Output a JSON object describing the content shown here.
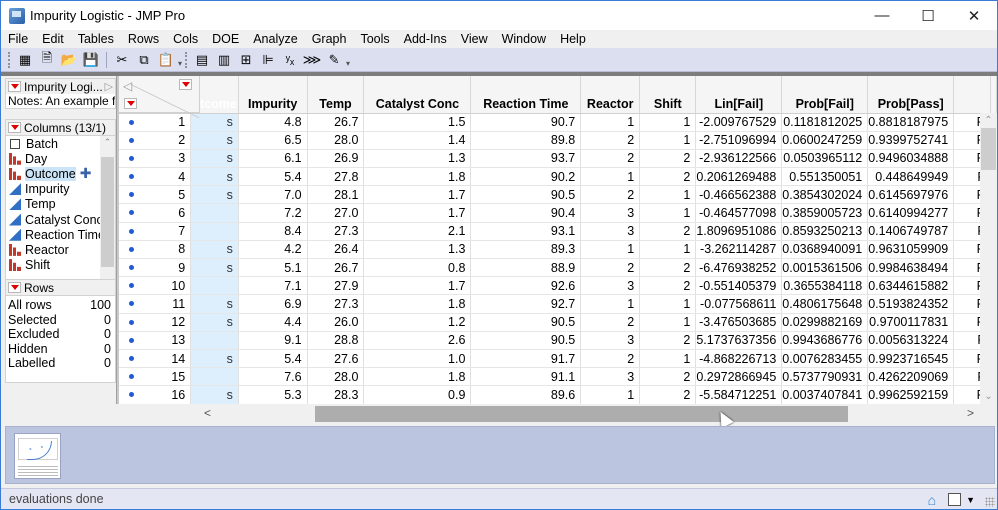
{
  "window": {
    "title": "Impurity Logistic - JMP Pro",
    "controls": {
      "minimize": "—",
      "maximize": "☐",
      "close": "✕"
    }
  },
  "menu": [
    "File",
    "Edit",
    "Tables",
    "Rows",
    "Cols",
    "DOE",
    "Analyze",
    "Graph",
    "Tools",
    "Add-Ins",
    "View",
    "Window",
    "Help"
  ],
  "toolbar": {
    "group1": [
      {
        "name": "new-data-table-icon",
        "glyph": "▦"
      },
      {
        "name": "new-script-icon",
        "glyph": "🗎"
      },
      {
        "name": "open-icon",
        "glyph": "📂"
      },
      {
        "name": "save-icon",
        "glyph": "💾"
      }
    ],
    "group2": [
      {
        "name": "cut-icon",
        "glyph": "✂"
      },
      {
        "name": "copy-icon",
        "glyph": "⧉"
      },
      {
        "name": "paste-icon",
        "glyph": "📋"
      }
    ],
    "group3": [
      {
        "name": "data-table-icon",
        "glyph": "▤"
      },
      {
        "name": "calculator-icon",
        "glyph": "▥"
      },
      {
        "name": "data-grid-icon",
        "glyph": "⊞"
      },
      {
        "name": "distribution-icon",
        "glyph": "⊫"
      },
      {
        "name": "fit-y-by-x-icon",
        "glyph": "ʸₓ"
      },
      {
        "name": "fit-model-icon",
        "glyph": "⋙"
      },
      {
        "name": "script-edit-icon",
        "glyph": "✎"
      }
    ],
    "more_glyph": "▾"
  },
  "table_panel": {
    "title": "Impurity Logi...",
    "notes": "Notes:  An example f",
    "arrow": "▷"
  },
  "columns_panel": {
    "title": "Columns (13/1)",
    "items": [
      {
        "label": "Batch",
        "type": "nominal-check"
      },
      {
        "label": "Day",
        "type": "ordinal"
      },
      {
        "label": "Outcome",
        "type": "ordinal",
        "selected": true
      },
      {
        "label": "Impurity",
        "type": "continuous"
      },
      {
        "label": "Temp",
        "type": "continuous"
      },
      {
        "label": "Catalyst Conc",
        "type": "continuous"
      },
      {
        "label": "Reaction Time",
        "type": "continuous"
      },
      {
        "label": "Reactor",
        "type": "ordinal"
      },
      {
        "label": "Shift",
        "type": "ordinal"
      }
    ],
    "drag_cursor": "✚"
  },
  "rows_panel": {
    "title": "Rows",
    "items": [
      {
        "label": "All rows",
        "value": "100"
      },
      {
        "label": "Selected",
        "value": "0"
      },
      {
        "label": "Excluded",
        "value": "0"
      },
      {
        "label": "Hidden",
        "value": "0"
      },
      {
        "label": "Labelled",
        "value": "0"
      }
    ]
  },
  "grid": {
    "corner_left_arrow": "◁",
    "headers": [
      "utcome",
      "Impurity",
      "Temp",
      "Catalyst Conc",
      "Reaction Time",
      "Reactor",
      "Shift",
      "Lin[Fail]",
      "Prob[Fail]",
      "Prob[Pass]",
      ""
    ],
    "rows": [
      {
        "n": "1",
        "outcome": "s",
        "cells": [
          "4.8",
          "26.7",
          "1.5",
          "90.7",
          "1",
          "1",
          "-2.009767529",
          "0.1181812025",
          "0.8818187975",
          "P"
        ]
      },
      {
        "n": "2",
        "outcome": "s",
        "cells": [
          "6.5",
          "28.0",
          "1.4",
          "89.8",
          "2",
          "1",
          "-2.751096994",
          "0.0600247259",
          "0.9399752741",
          "P"
        ]
      },
      {
        "n": "3",
        "outcome": "s",
        "cells": [
          "6.1",
          "26.9",
          "1.3",
          "93.7",
          "2",
          "2",
          "-2.936122566",
          "0.0503965112",
          "0.9496034888",
          "P"
        ]
      },
      {
        "n": "4",
        "outcome": "s",
        "cells": [
          "5.4",
          "27.8",
          "1.8",
          "90.2",
          "1",
          "2",
          "0.2061269488",
          "0.551350051",
          "0.448649949",
          "F"
        ]
      },
      {
        "n": "5",
        "outcome": "s",
        "cells": [
          "7.0",
          "28.1",
          "1.7",
          "90.5",
          "2",
          "1",
          "-0.466562388",
          "0.3854302024",
          "0.6145697976",
          "P"
        ]
      },
      {
        "n": "6",
        "outcome": "",
        "cells": [
          "7.2",
          "27.0",
          "1.7",
          "90.4",
          "3",
          "1",
          "-0.464577098",
          "0.3859005723",
          "0.6140994277",
          "P"
        ]
      },
      {
        "n": "7",
        "outcome": "",
        "cells": [
          "8.4",
          "27.3",
          "2.1",
          "93.1",
          "3",
          "2",
          "1.8096951086",
          "0.8593250213",
          "0.1406749787",
          "F"
        ]
      },
      {
        "n": "8",
        "outcome": "s",
        "cells": [
          "4.2",
          "26.4",
          "1.3",
          "89.3",
          "1",
          "1",
          "-3.262114287",
          "0.0368940091",
          "0.9631059909",
          "P"
        ]
      },
      {
        "n": "9",
        "outcome": "s",
        "cells": [
          "5.1",
          "26.7",
          "0.8",
          "88.9",
          "2",
          "2",
          "-6.476938252",
          "0.0015361506",
          "0.9984638494",
          "P"
        ]
      },
      {
        "n": "10",
        "outcome": "",
        "cells": [
          "7.1",
          "27.9",
          "1.7",
          "92.6",
          "3",
          "2",
          "-0.551405379",
          "0.3655384118",
          "0.6344615882",
          "P"
        ]
      },
      {
        "n": "11",
        "outcome": "s",
        "cells": [
          "6.9",
          "27.3",
          "1.8",
          "92.7",
          "1",
          "1",
          "-0.077568611",
          "0.4806175648",
          "0.5193824352",
          "P"
        ]
      },
      {
        "n": "12",
        "outcome": "s",
        "cells": [
          "4.4",
          "26.0",
          "1.2",
          "90.5",
          "2",
          "1",
          "-3.476503685",
          "0.0299882169",
          "0.9700117831",
          "P"
        ]
      },
      {
        "n": "13",
        "outcome": "",
        "cells": [
          "9.1",
          "28.8",
          "2.6",
          "90.5",
          "3",
          "2",
          "5.1737637356",
          "0.9943686776",
          "0.0056313224",
          "F"
        ]
      },
      {
        "n": "14",
        "outcome": "s",
        "cells": [
          "5.4",
          "27.6",
          "1.0",
          "91.7",
          "2",
          "1",
          "-4.868226713",
          "0.0076283455",
          "0.9923716545",
          "P"
        ]
      },
      {
        "n": "15",
        "outcome": "",
        "cells": [
          "7.6",
          "28.0",
          "1.8",
          "91.1",
          "3",
          "2",
          "0.2972866945",
          "0.5737790931",
          "0.4262209069",
          "F"
        ]
      },
      {
        "n": "16",
        "outcome": "s",
        "cells": [
          "5.3",
          "28.3",
          "0.9",
          "89.6",
          "1",
          "2",
          "-5.584712251",
          "0.0037407841",
          "0.9962592159",
          "P"
        ]
      }
    ],
    "scroll": {
      "up": "⌃",
      "down": "⌄",
      "left": "<",
      "right": ">"
    }
  },
  "status": {
    "text": "evaluations done",
    "home_glyph": "⌂",
    "dropdown_glyph": "▼"
  },
  "colors": {
    "selected_column_header": "#3d97f2",
    "selected_column_cells": "#ddeefd",
    "row_state_dot": "#1f5bd6",
    "toolbar_bg": "#dcdff0",
    "thumb_strip_bg": "#bcc5e0"
  }
}
